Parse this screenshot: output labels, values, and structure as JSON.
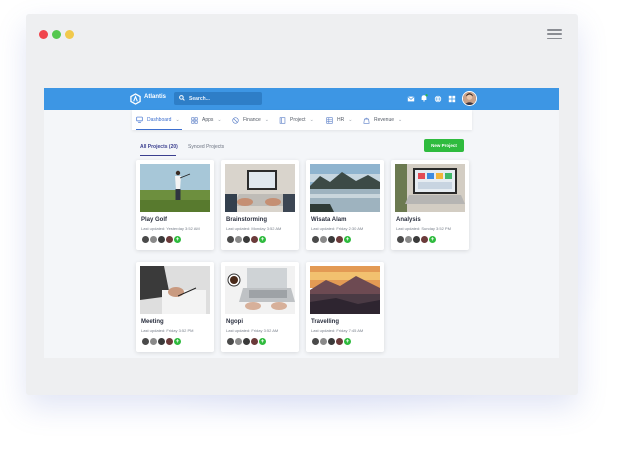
{
  "app": {
    "brand": "Atlantis",
    "search_placeholder": "Search..."
  },
  "nav": [
    {
      "label": "Dashboard",
      "icon": "monitor-icon",
      "active": true
    },
    {
      "label": "Apps",
      "icon": "grid-icon",
      "active": false
    },
    {
      "label": "Finance",
      "icon": "money-icon",
      "active": false
    },
    {
      "label": "Project",
      "icon": "clipboard-icon",
      "active": false
    },
    {
      "label": "HR",
      "icon": "table-icon",
      "active": false
    },
    {
      "label": "Revenue",
      "icon": "bag-icon",
      "active": false
    }
  ],
  "tabs": {
    "all": "All Projects  (20)",
    "synced": "Synced Projects"
  },
  "new_project": "New Project",
  "projects": [
    {
      "title": "Play Golf",
      "updated": "Last updated: Yesterday 3:52 AM"
    },
    {
      "title": "Brainstorming",
      "updated": "Last updated: Monday 3:52 AM"
    },
    {
      "title": "Wisata Alam",
      "updated": "Last updated: Friday 2:30 AM"
    },
    {
      "title": "Analysis",
      "updated": "Last updated: Sunday 3:52 PM"
    },
    {
      "title": "Meeting",
      "updated": "Last updated: Friday 3:52 PM"
    },
    {
      "title": "Ngopi",
      "updated": "Last updated: Friday 3:52 AM"
    },
    {
      "title": "Travelling",
      "updated": "Last updated: Friday 7:45 AM"
    }
  ],
  "avatar_more": "+",
  "colors": {
    "primary": "#3d96e4",
    "accent": "#2fbb3e",
    "nav_active": "#3d6fcf"
  }
}
